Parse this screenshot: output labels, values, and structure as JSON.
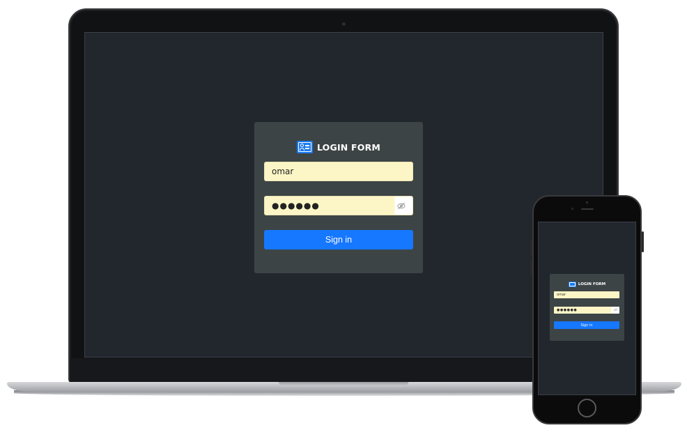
{
  "login_form": {
    "title": "LOGIN FORM",
    "username_value": "omar",
    "password_masked": "●●●●●●",
    "signin_label": "Sign in"
  },
  "icons": {
    "header": "id-card-icon",
    "password_toggle": "eye-slash-icon"
  },
  "colors": {
    "screen_bg": "#22272e",
    "card_bg": "#3d4446",
    "input_bg": "#fcf6c6",
    "button_bg": "#1677ff",
    "icon_bg": "#1a7af0"
  }
}
